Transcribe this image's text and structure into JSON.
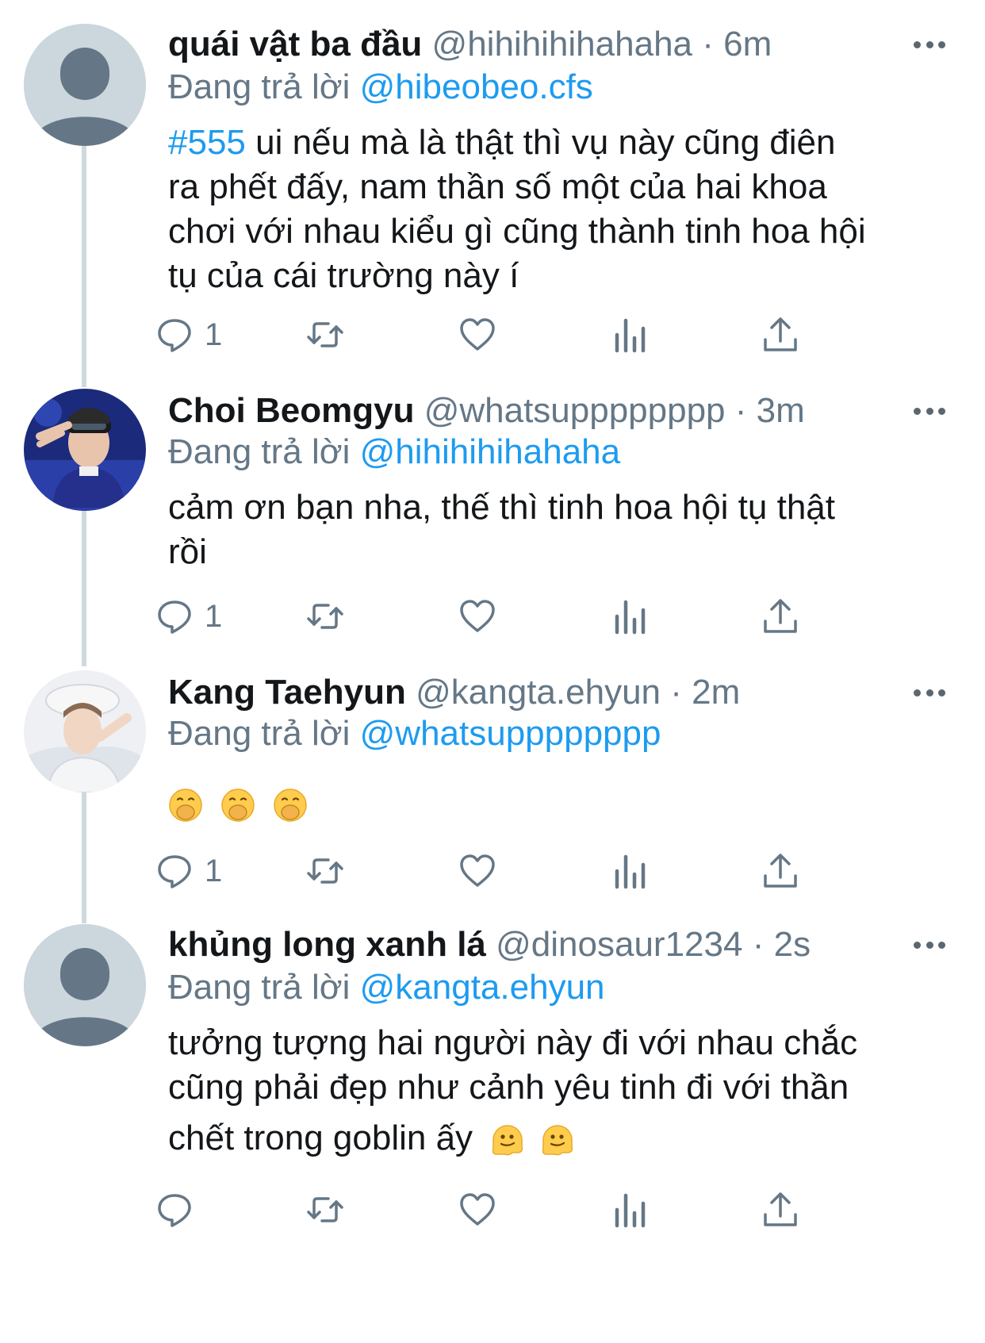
{
  "reply_prefix": "Đang trả lời",
  "tweets": [
    {
      "name": "quái vật ba đầu",
      "handle": "@hihihihihahaha",
      "time": "6m",
      "reply_to": "@hibeobeo.cfs",
      "hashtag": "#555",
      "lines": [
        " ui nếu mà là thật thì vụ này cũng điên",
        "ra phết đấy, nam thần số một của hai khoa",
        "chơi với nhau kiểu gì cũng thành tinh hoa hội",
        "tụ của cái trường này í"
      ],
      "reply_count": "1",
      "avatar": "default-avatar"
    },
    {
      "name": "Choi Beomgyu",
      "handle": "@whatsupppppppp",
      "time": "3m",
      "reply_to": "@hihihihihahaha",
      "lines": [
        "cảm ơn bạn nha, thế thì tinh hoa hội tụ thật",
        "rồi"
      ],
      "reply_count": "1",
      "avatar": "photo-avatar-blue"
    },
    {
      "name": "Kang Taehyun",
      "handle": "@kangta.ehyun",
      "time": "2m",
      "reply_to": "@whatsupppppppp",
      "emojis": [
        "hand-over-mouth-emoji",
        "hand-over-mouth-emoji",
        "hand-over-mouth-emoji"
      ],
      "reply_count": "1",
      "avatar": "photo-avatar-white"
    },
    {
      "name": "khủng long xanh lá",
      "handle": "@dinosaur1234",
      "time": "2s",
      "reply_to": "@kangta.ehyun",
      "lines": [
        "tưởng tượng hai người này đi với nhau chắc",
        "cũng phải đẹp như cảnh yêu tinh đi với thần",
        "chết trong goblin ấy"
      ],
      "trailing_emojis": [
        "melting-face-emoji",
        "melting-face-emoji"
      ],
      "reply_count": "",
      "avatar": "default-avatar"
    }
  ],
  "separator": "·",
  "colors": {
    "accent": "#1d9bf0",
    "secondary_text": "#657786",
    "thread_line": "#cfd9de",
    "avatar_default_bg": "#ccd6dd",
    "avatar_default_fg": "#657786"
  },
  "icons": [
    "reply-icon",
    "retweet-icon",
    "like-icon",
    "analytics-icon",
    "share-icon",
    "more-icon"
  ]
}
